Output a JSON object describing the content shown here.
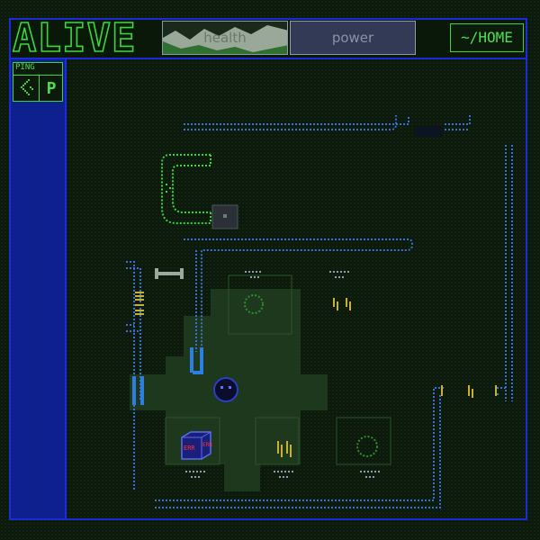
{
  "app": {
    "title": "ALIVE"
  },
  "meters": {
    "health": {
      "label": "health",
      "level": 0.55
    },
    "power": {
      "label": "power",
      "level": 0.0
    }
  },
  "nav": {
    "home_label": "~/HOME"
  },
  "sidebar": {
    "ping": {
      "label": "PING",
      "key": "P",
      "icon": "ping-icon"
    }
  },
  "map": {
    "crate_label": "ERR",
    "icons": [
      "player-icon",
      "crate-icon",
      "door-icon",
      "bone-icon",
      "ring-icon",
      "terminal-icon"
    ]
  },
  "colors": {
    "accent": "#3cd63c",
    "frame_blue": "#1b2bd8",
    "wall_blue": "#3a6fd8",
    "door_yellow": "#c8b030",
    "sidebar_blue": "#0e1f8e"
  }
}
